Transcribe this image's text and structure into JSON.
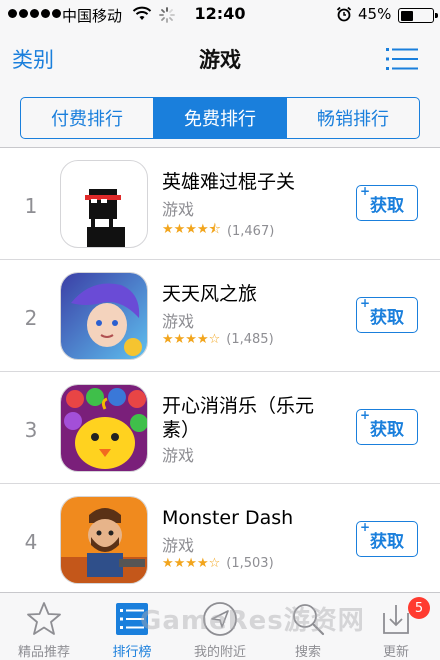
{
  "status_bar": {
    "carrier": "中国移动",
    "time": "12:40",
    "battery_percent": "45%",
    "battery_level": 0.45
  },
  "nav": {
    "left_label": "类别",
    "title": "游戏",
    "right_icon": "list-icon"
  },
  "segments": [
    {
      "label": "付费排行",
      "active": false
    },
    {
      "label": "免费排行",
      "active": true
    },
    {
      "label": "畅销排行",
      "active": false
    }
  ],
  "apps": [
    {
      "rank": "1",
      "name": "英雄难过棍子关",
      "category": "游戏",
      "stars": 4.5,
      "rating_count": "(1,467)",
      "button": "获取"
    },
    {
      "rank": "2",
      "name": "天天风之旅",
      "category": "游戏",
      "stars": 4.0,
      "rating_count": "(1,485)",
      "button": "获取"
    },
    {
      "rank": "3",
      "name": "开心消消乐（乐元素）",
      "category": "游戏",
      "stars": null,
      "rating_count": "",
      "button": "获取"
    },
    {
      "rank": "4",
      "name": "Monster Dash",
      "category": "游戏",
      "stars": 4.0,
      "rating_count": "(1,503)",
      "button": "获取"
    }
  ],
  "tabs": [
    {
      "label": "精品推荐",
      "icon": "star-icon",
      "active": false
    },
    {
      "label": "排行榜",
      "icon": "ranking-icon",
      "active": true
    },
    {
      "label": "我的附近",
      "icon": "location-icon",
      "active": false
    },
    {
      "label": "搜索",
      "icon": "search-icon",
      "active": false
    },
    {
      "label": "更新",
      "icon": "update-icon",
      "active": false,
      "badge": "5"
    }
  ],
  "watermark": "GameRes游资网",
  "colors": {
    "accent": "#1a7fdc",
    "star": "#f2a51d",
    "badge": "#ff3b30"
  }
}
